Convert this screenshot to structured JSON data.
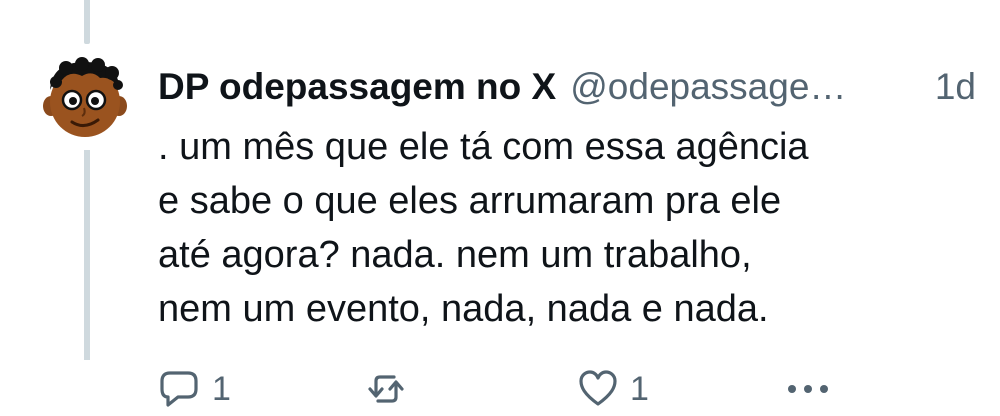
{
  "tweet": {
    "display_name": "DP odepassagem no X",
    "handle": "@odepassage…",
    "time": "1d",
    "text_lines": [
      ". um mês que ele tá com essa agência",
      "e sabe o que eles arrumaram pra ele",
      "até agora? nada. nem um trabalho,",
      "nem um evento, nada, nada e nada."
    ],
    "avatar_icon": "cartoon-face-avatar"
  },
  "actions": {
    "reply": {
      "icon": "reply-icon",
      "count": "1"
    },
    "retweet": {
      "icon": "retweet-icon",
      "count": ""
    },
    "like": {
      "icon": "heart-icon",
      "count": "1"
    },
    "more": {
      "icon": "more-icon"
    }
  },
  "colors": {
    "text": "#0f1419",
    "secondary": "#536471",
    "thread_line": "#cfd9de"
  }
}
